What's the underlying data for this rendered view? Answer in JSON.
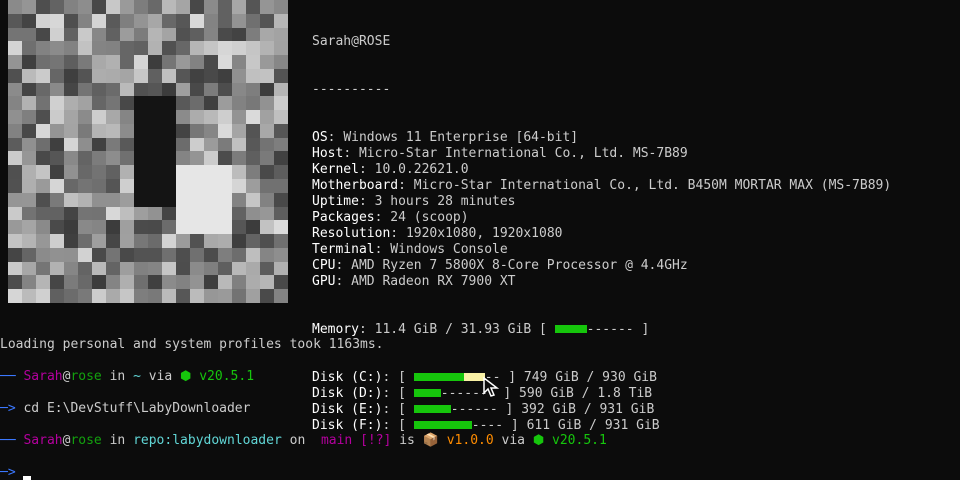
{
  "colors": {
    "background": "#0c0c0c",
    "text": "#cccccc",
    "accent_green": "#16c60c",
    "accent_yellow": "#f9f1a5"
  },
  "header": {
    "user": "Sarah@ROSE",
    "separator": "----------"
  },
  "info": [
    {
      "key": "OS",
      "value": "Windows 11 Enterprise [64-bit]"
    },
    {
      "key": "Host",
      "value": "Micro-Star International Co., Ltd. MS-7B89"
    },
    {
      "key": "Kernel",
      "value": "10.0.22621.0"
    },
    {
      "key": "Motherboard",
      "value": "Micro-Star International Co., Ltd. B450M MORTAR MAX (MS-7B89)"
    },
    {
      "key": "Uptime",
      "value": "3 hours 28 minutes"
    },
    {
      "key": "Packages",
      "value": "24 (scoop)"
    },
    {
      "key": "Resolution",
      "value": "1920x1080, 1920x1080"
    },
    {
      "key": "Terminal",
      "value": "Windows Console"
    },
    {
      "key": "CPU",
      "value": "AMD Ryzen 7 5800X 8-Core Processor @ 4.4GHz"
    },
    {
      "key": "GPU",
      "value": "AMD Radeon RX 7900 XT"
    }
  ],
  "memory": {
    "key": "Memory",
    "value": "11.4 GiB / 31.93 GiB",
    "fraction": 0.36,
    "bar_remainder": "------"
  },
  "disks": [
    {
      "key": "Disk (C:)",
      "value": "749 GiB / 930 GiB",
      "fraction": 0.81,
      "bar_remainder": "--"
    },
    {
      "key": "Disk (D:)",
      "value": "590 GiB / 1.8 TiB",
      "fraction": 0.31,
      "bar_remainder": "-------"
    },
    {
      "key": "Disk (E:)",
      "value": "392 GiB / 931 GiB",
      "fraction": 0.42,
      "bar_remainder": "------"
    },
    {
      "key": "Disk (F:)",
      "value": "611 GiB / 931 GiB",
      "fraction": 0.66,
      "bar_remainder": "----"
    }
  ],
  "loading_message": "Loading personal and system profiles took 1163ms.",
  "prompt1": {
    "dash": "──",
    "user": "Sarah",
    "at": "@",
    "host": "rose",
    "in": "in",
    "dir": "~",
    "via": "via",
    "node_icon": "⬢",
    "node_version": "v20.5.1"
  },
  "command1": {
    "arrow": "─>",
    "text": "cd E:\\DevStuff\\LabyDownloader"
  },
  "prompt2": {
    "dash": "──",
    "user": "Sarah",
    "at": "@",
    "host": "rose",
    "in": "in",
    "dir": "repo:labydownloader",
    "on": "on",
    "git_icon": "",
    "branch": "main",
    "status": "[!?]",
    "is": "is",
    "pkg_icon": "📦",
    "pkg_version": "v1.0.0",
    "via": "via",
    "node_icon": "⬢",
    "node_version": "v20.5.1"
  },
  "command2": {
    "arrow": "─>"
  }
}
